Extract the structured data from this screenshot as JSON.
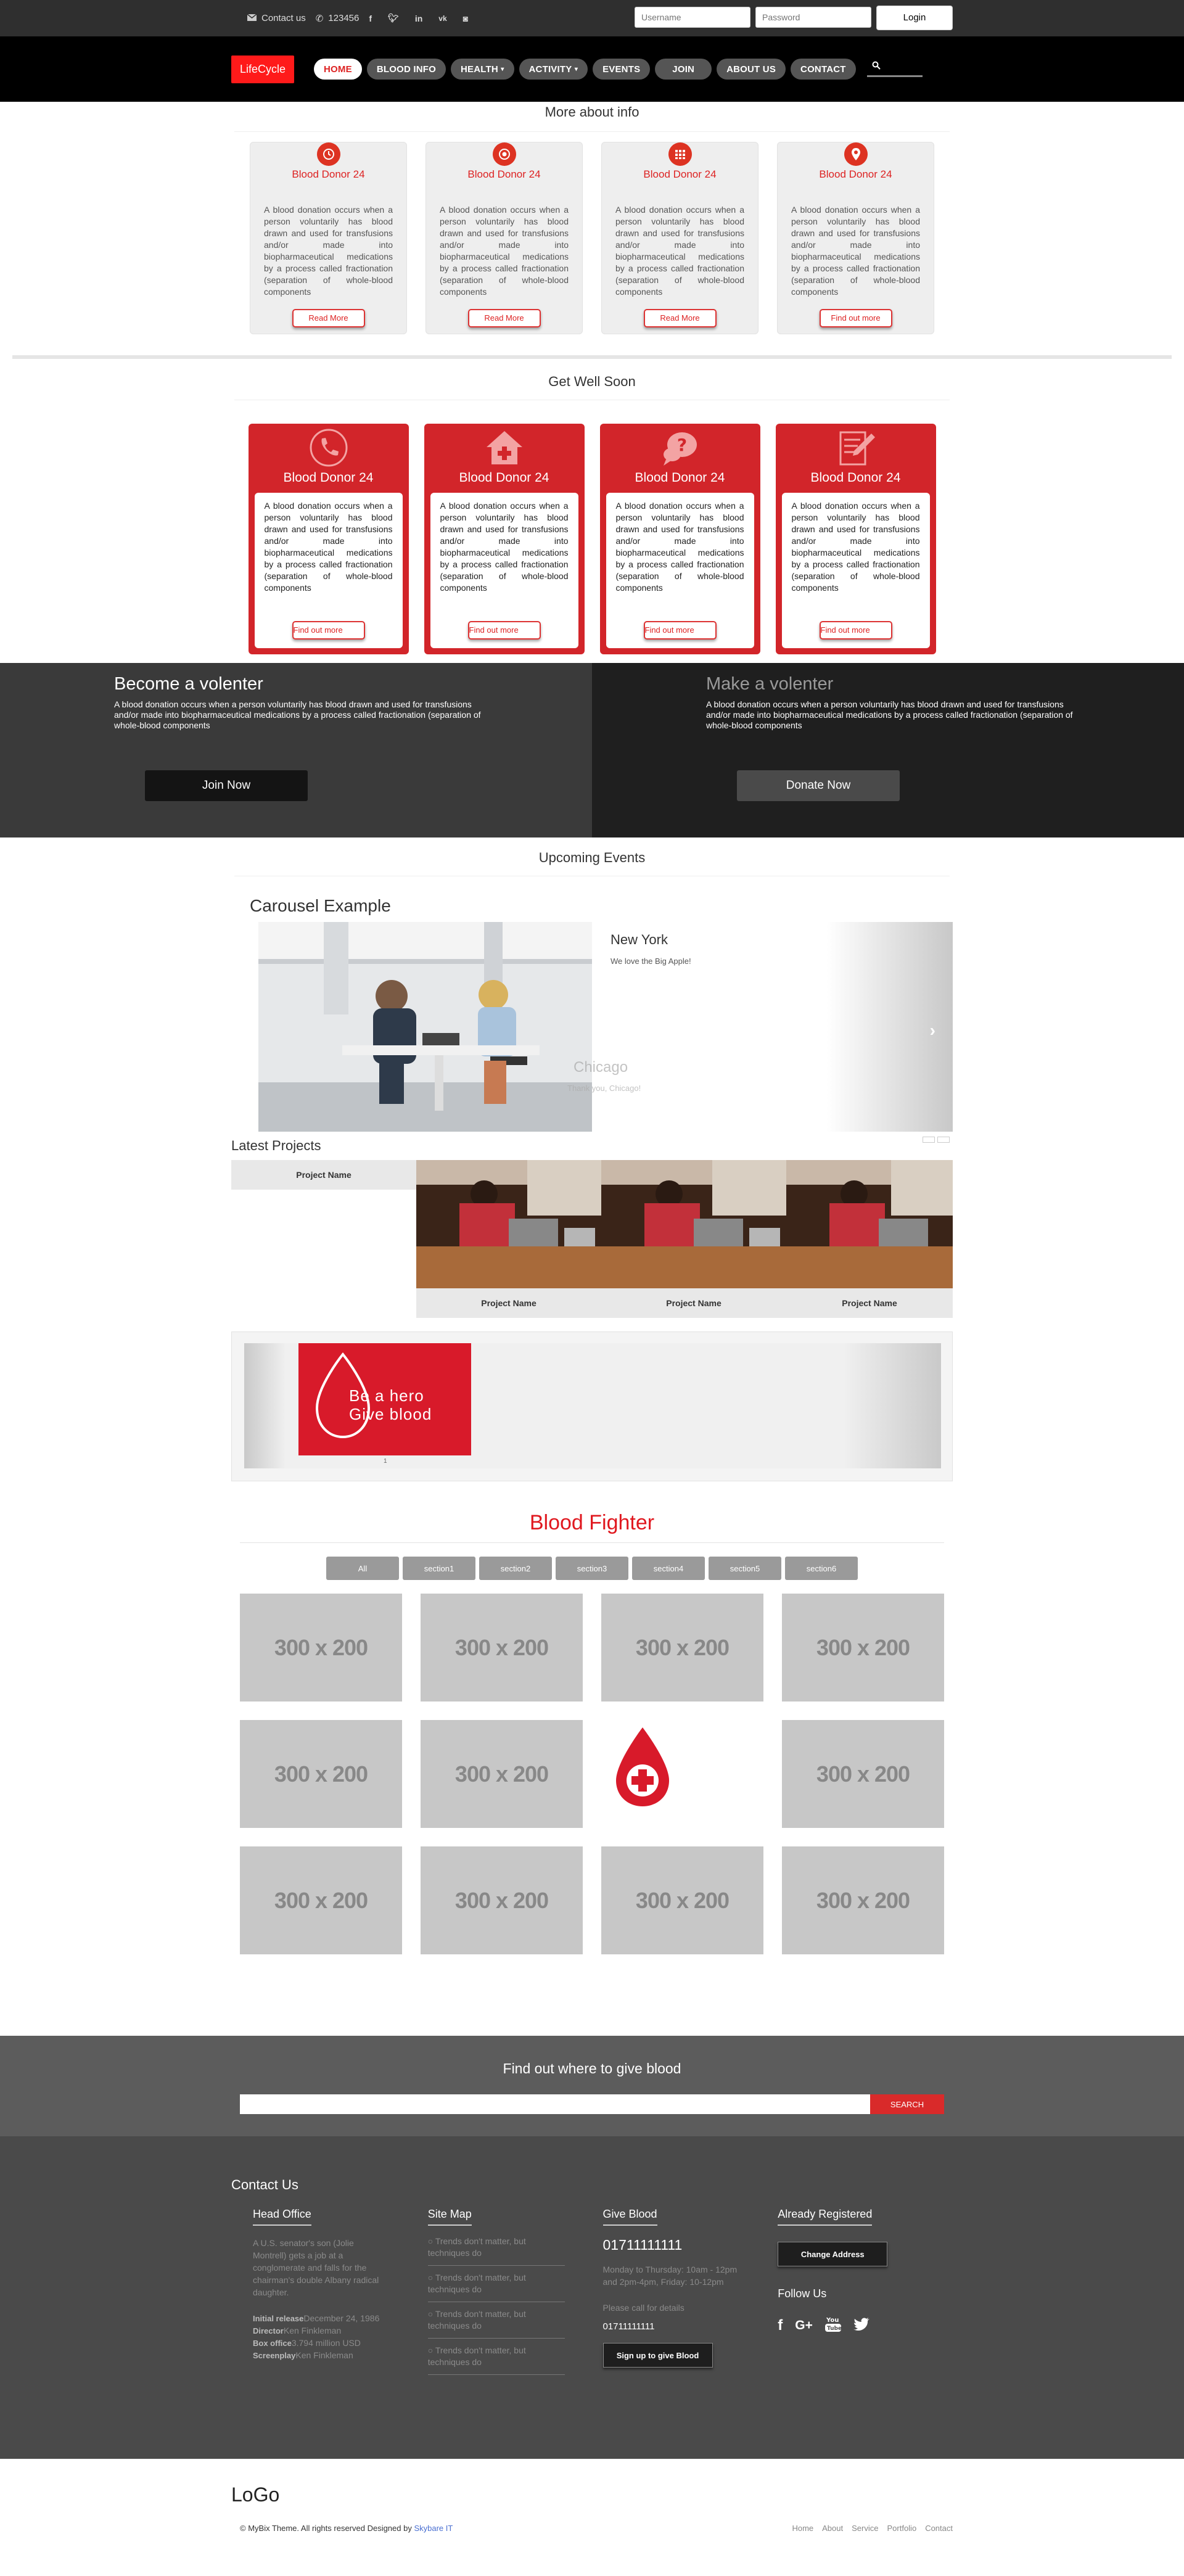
{
  "topbar": {
    "contact_label": "Contact us",
    "phone": "123456",
    "social_icons": [
      "facebook-icon",
      "twitter-icon",
      "linkedin-icon",
      "vk-icon",
      "instagram-icon"
    ],
    "username_placeholder": "Username",
    "password_placeholder": "Password",
    "login_label": "Login"
  },
  "nav": {
    "logo": "LifeCycle",
    "items": [
      "HOME",
      "BLOOD INFO",
      "HEALTH",
      "ACTIVITY",
      "EVENTS",
      "JOIN",
      "ABOUT US",
      "CONTACT"
    ],
    "dropdown_marker": "▾"
  },
  "info": {
    "title": "More about info",
    "cards": [
      {
        "icon": "clock-icon",
        "title": "Blood Donor 24",
        "text": "A blood donation occurs when a person voluntarily has blood drawn and used for transfusions and/or made into biopharmaceutical medications by a process called fractionation (separation of whole-blood components",
        "button": "Read More"
      },
      {
        "icon": "target-icon",
        "title": "Blood Donor 24",
        "text": "A blood donation occurs when a person voluntarily has blood drawn and used for transfusions and/or made into biopharmaceutical medications by a process called fractionation (separation of whole-blood components",
        "button": "Read More"
      },
      {
        "icon": "calendar-icon",
        "title": "Blood Donor 24",
        "text": "A blood donation occurs when a person voluntarily has blood drawn and used for transfusions and/or made into biopharmaceutical medications by a process called fractionation (separation of whole-blood components",
        "button": "Read More"
      },
      {
        "icon": "map-marker-icon",
        "title": "Blood Donor 24",
        "text": "A blood donation occurs when a person voluntarily has blood drawn and used for transfusions and/or made into biopharmaceutical medications by a process called fractionation (separation of whole-blood components",
        "button": "Find out more"
      }
    ]
  },
  "getwell": {
    "title": "Get Well Soon",
    "cards": [
      {
        "icon": "phone-icon",
        "title": "Blood Donor 24",
        "text": "A blood donation occurs when a person voluntarily has blood drawn and used for transfusions and/or made into biopharmaceutical medications by a process called fractionation (separation of whole-blood components",
        "button": "Find out more"
      },
      {
        "icon": "medical-house-icon",
        "title": "Blood Donor 24",
        "text": "A blood donation occurs when a person voluntarily has blood drawn and used for transfusions and/or made into biopharmaceutical medications by a process called fractionation (separation of whole-blood components",
        "button": "Find out more"
      },
      {
        "icon": "question-chat-icon",
        "title": "Blood Donor 24",
        "text": "A blood donation occurs when a person voluntarily has blood drawn and used for transfusions and/or made into biopharmaceutical medications by a process called fractionation (separation of whole-blood components",
        "button": "Find out more"
      },
      {
        "icon": "edit-note-icon",
        "title": "Blood Donor 24",
        "text": "A blood donation occurs when a person voluntarily has blood drawn and used for transfusions and/or made into biopharmaceutical medications by a process called fractionation (separation of whole-blood components",
        "button": "Find out more"
      }
    ]
  },
  "volunteer": {
    "left": {
      "title": "Become a volenter",
      "text": "A blood donation occurs when a person voluntarily has blood drawn and used for transfusions and/or made into biopharmaceutical medications by a process called fractionation (separation of whole-blood components",
      "button": "Join Now"
    },
    "right": {
      "title": "Make a volenter",
      "text": "A blood donation occurs when a person voluntarily has blood drawn and used for transfusions and/or made into biopharmaceutical medications by a process called fractionation (separation of whole-blood components",
      "button": "Donate Now"
    }
  },
  "events": {
    "title": "Upcoming Events",
    "carousel_title": "Carousel Example",
    "slide_title": "New York",
    "slide_text": "We love the Big Apple!",
    "ghost_title": "Chicago",
    "ghost_text": "Thank you, Chicago!"
  },
  "projects": {
    "title": "Latest Projects",
    "items": [
      "Project Name",
      "Project Name",
      "Project Name",
      "Project Name"
    ]
  },
  "banner": {
    "line1": "Be a hero",
    "line2": "Give blood",
    "page": "1"
  },
  "gallery": {
    "title": "Blood Fighter",
    "filters": [
      "All",
      "section1",
      "section2",
      "section3",
      "section4",
      "section5",
      "section6"
    ],
    "placeholder": "300 x 200"
  },
  "find": {
    "title": "Find out where to give blood",
    "button": "SEARCH"
  },
  "contact": {
    "title": "Contact Us",
    "head_office": {
      "heading": "Head Office",
      "text": "A U.S. senator's son (Jolie Montrell) gets a job at a conglomerate and falls for the chairman's double Albany radical daughter.",
      "details": [
        {
          "label": "Initial release",
          "value": "December 24, 1986"
        },
        {
          "label": "Director",
          "value": "Ken Finkleman"
        },
        {
          "label": "Box office",
          "value": "3.794 million USD"
        },
        {
          "label": "Screenplay",
          "value": "Ken Finkleman"
        }
      ]
    },
    "sitemap": {
      "heading": "Site Map",
      "items": [
        "Trends don't matter, but techniques do",
        "Trends don't matter, but techniques do",
        "Trends don't matter, but techniques do",
        "Trends don't matter, but techniques do"
      ]
    },
    "give_blood": {
      "heading": "Give Blood",
      "phone_big": "01711111111",
      "hours": "Monday to Thursday: 10am - 12pm and 2pm-4pm, Friday: 10-12pm",
      "call_label": "Please call for details",
      "phone_small": "01711111111",
      "button": "Sign up to give Blood"
    },
    "registered": {
      "heading": "Already Registered",
      "button": "Change Address",
      "follow": "Follow Us"
    }
  },
  "footer": {
    "logo": "LoGo",
    "copyright": "© MyBix Theme. All rights reserved Designed by",
    "designer": "Skybare IT",
    "links": [
      "Home",
      "About",
      "Service",
      "Portfolio",
      "Contact"
    ]
  }
}
